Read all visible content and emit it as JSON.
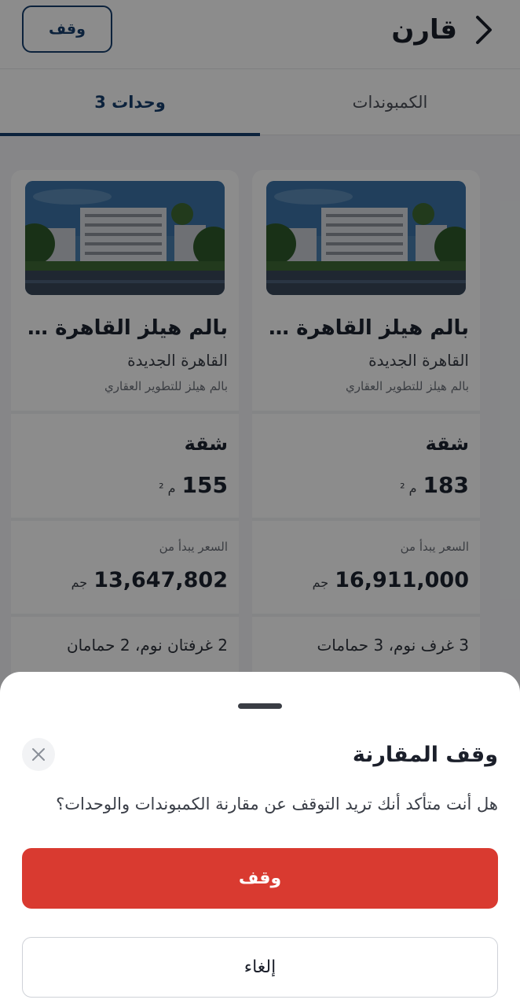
{
  "header": {
    "title": "قارن",
    "stop_button": "وقف",
    "back_icon": "chevron-right-icon"
  },
  "tabs": [
    {
      "label": "الكمبوندات",
      "active": false
    },
    {
      "label": "3 وحدات",
      "active": true
    }
  ],
  "units": [
    {
      "name": "بالم هيلز القاهرة الجد...",
      "city": "القاهرة الجديدة",
      "developer": "بالم هيلز للتطوير العقاري",
      "type": "شقة",
      "area": "183",
      "area_unit": "م ²",
      "price_label": "السعر يبدأ من",
      "price": "16,911,000",
      "currency": "جم",
      "rooms": "3 غرف نوم، 3 حمامات"
    },
    {
      "name": "بالم هيلز القاهرة الجد...",
      "city": "القاهرة الجديدة",
      "developer": "بالم هيلز للتطوير العقاري",
      "type": "شقة",
      "area": "155",
      "area_unit": "م ²",
      "price_label": "السعر يبدأ من",
      "price": "13,647,802",
      "currency": "جم",
      "rooms": "2 غرفتان نوم، 2 حمامان"
    }
  ],
  "dialog": {
    "title": "وقف المقارنة",
    "message": "هل أنت متأكد أنك تريد التوقف عن مقارنة الكمبوندات والوحدات؟",
    "confirm_label": "وقف",
    "cancel_label": "إلغاء",
    "close_icon": "close-icon"
  },
  "colors": {
    "brand": "#173f6d",
    "danger": "#d93a30",
    "overlay": "rgba(0,0,0,0.45)"
  }
}
